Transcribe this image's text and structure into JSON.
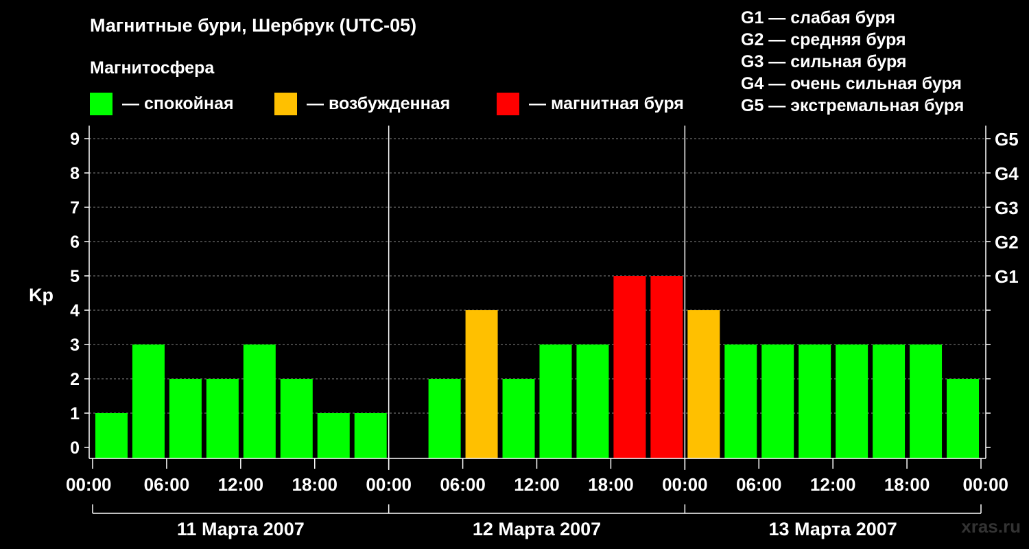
{
  "header": {
    "title": "Магнитные бури, Шербрук (UTC-05)",
    "subtitle": "Магнитосфера"
  },
  "legend": {
    "items": [
      {
        "label": "— спокойная",
        "color": "#00ff00"
      },
      {
        "label": "— возбужденная",
        "color": "#ffc000"
      },
      {
        "label": "— магнитная буря",
        "color": "#ff0000"
      }
    ]
  },
  "storm_scale": [
    "G1 — слабая буря",
    "G2 — средняя буря",
    "G3 — сильная буря",
    "G4 — очень сильная буря",
    "G5 — экстремальная буря"
  ],
  "watermark": "xras.ru",
  "chart_data": {
    "type": "bar",
    "ylabel": "Kp",
    "ylim": [
      0,
      9
    ],
    "yticks": [
      "0",
      "1",
      "2",
      "3",
      "4",
      "5",
      "6",
      "7",
      "8",
      "9"
    ],
    "right_ticks": [
      {
        "kp": 5,
        "label": "G1"
      },
      {
        "kp": 6,
        "label": "G2"
      },
      {
        "kp": 7,
        "label": "G3"
      },
      {
        "kp": 8,
        "label": "G4"
      },
      {
        "kp": 9,
        "label": "G5"
      }
    ],
    "xticks": [
      "00:00",
      "06:00",
      "12:00",
      "18:00",
      "00:00",
      "06:00",
      "12:00",
      "18:00",
      "00:00",
      "06:00",
      "12:00",
      "18:00",
      "00:00"
    ],
    "days": [
      "11 Марта 2007",
      "12 Марта 2007",
      "13 Марта 2007"
    ],
    "grid": true,
    "categories": [
      "11 Марта 2007 00:00-03:00",
      "11 Марта 2007 03:00-06:00",
      "11 Марта 2007 06:00-09:00",
      "11 Марта 2007 09:00-12:00",
      "11 Марта 2007 12:00-15:00",
      "11 Марта 2007 15:00-18:00",
      "11 Марта 2007 18:00-21:00",
      "11 Марта 2007 21:00-24:00",
      "12 Марта 2007 00:00-03:00",
      "12 Марта 2007 03:00-06:00",
      "12 Марта 2007 06:00-09:00",
      "12 Марта 2007 09:00-12:00",
      "12 Марта 2007 12:00-15:00",
      "12 Марта 2007 15:00-18:00",
      "12 Марта 2007 18:00-21:00",
      "12 Марта 2007 21:00-24:00",
      "13 Марта 2007 00:00-03:00",
      "13 Марта 2007 03:00-06:00",
      "13 Марта 2007 06:00-09:00",
      "13 Марта 2007 09:00-12:00",
      "13 Марта 2007 12:00-15:00",
      "13 Марта 2007 15:00-18:00",
      "13 Марта 2007 18:00-21:00",
      "13 Марта 2007 21:00-24:00"
    ],
    "values": [
      1,
      3,
      2,
      2,
      3,
      2,
      1,
      1,
      null,
      2,
      4,
      2,
      3,
      3,
      5,
      5,
      4,
      3,
      3,
      3,
      3,
      3,
      3,
      2
    ],
    "status": [
      "quiet",
      "quiet",
      "quiet",
      "quiet",
      "quiet",
      "quiet",
      "quiet",
      "quiet",
      null,
      "quiet",
      "active",
      "quiet",
      "quiet",
      "quiet",
      "storm",
      "storm",
      "active",
      "quiet",
      "quiet",
      "quiet",
      "quiet",
      "quiet",
      "quiet",
      "quiet"
    ],
    "colors": {
      "quiet": "#00ff00",
      "active": "#ffc000",
      "storm": "#ff0000"
    }
  }
}
